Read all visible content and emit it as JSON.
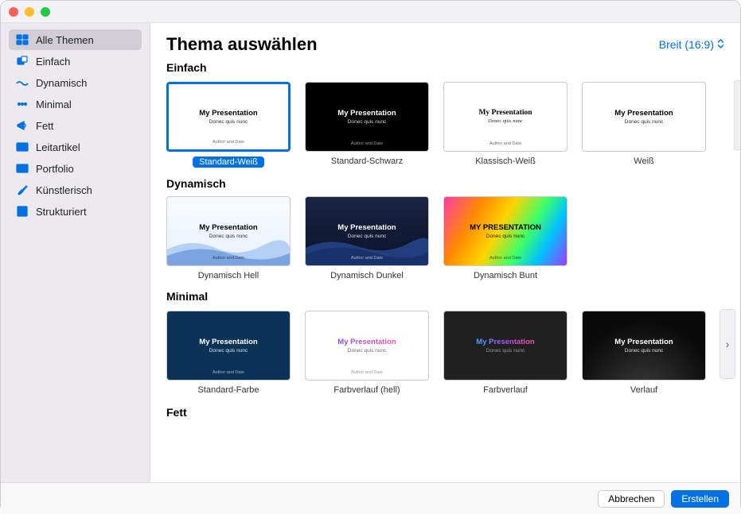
{
  "header": {
    "title": "Thema auswählen",
    "ratio": "Breit (16:9)"
  },
  "thumb_text": {
    "title": "My Presentation",
    "title_upper": "MY PRESENTATION",
    "sub": "Donec quis nunc",
    "foot": "Author and Date"
  },
  "sidebar": [
    {
      "label": "Alle Themen",
      "icon": "grid",
      "selected": true
    },
    {
      "label": "Einfach",
      "icon": "squares",
      "selected": false
    },
    {
      "label": "Dynamisch",
      "icon": "wave",
      "selected": false
    },
    {
      "label": "Minimal",
      "icon": "dots",
      "selected": false
    },
    {
      "label": "Fett",
      "icon": "megaphone",
      "selected": false
    },
    {
      "label": "Leitartikel",
      "icon": "slide",
      "selected": false
    },
    {
      "label": "Portfolio",
      "icon": "slide",
      "selected": false
    },
    {
      "label": "Künstlerisch",
      "icon": "brush",
      "selected": false
    },
    {
      "label": "Strukturiert",
      "icon": "texture",
      "selected": false
    }
  ],
  "sections": [
    {
      "title": "Einfach",
      "scroll": false,
      "peek": true,
      "cards": [
        {
          "name": "Standard-Weiß",
          "bg": "#ffffff",
          "fg": "#000000",
          "center": false,
          "foot": true,
          "selected": true
        },
        {
          "name": "Standard-Schwarz",
          "bg": "#000000",
          "fg": "#ffffff",
          "center": false,
          "foot": true,
          "selected": false
        },
        {
          "name": "Klassisch-Weiß",
          "bg": "#ffffff",
          "fg": "#000000",
          "center": true,
          "foot": true,
          "serif": true,
          "selected": false
        },
        {
          "name": "Weiß",
          "bg": "#ffffff",
          "fg": "#000000",
          "center": true,
          "foot": false,
          "selected": false
        }
      ]
    },
    {
      "title": "Dynamisch",
      "scroll": false,
      "peek": false,
      "cards": [
        {
          "name": "Dynamisch Hell",
          "style": "wave-light",
          "fg": "#000000",
          "center": false,
          "foot": true,
          "selected": false
        },
        {
          "name": "Dynamisch Dunkel",
          "style": "wave-dark",
          "fg": "#ffffff",
          "center": false,
          "foot": true,
          "selected": false
        },
        {
          "name": "Dynamisch Bunt",
          "style": "rainbow",
          "fg": "#000000",
          "center": false,
          "upper": true,
          "foot": true,
          "selected": false
        }
      ]
    },
    {
      "title": "Minimal",
      "scroll": true,
      "peek": false,
      "cards": [
        {
          "name": "Standard-Farbe",
          "bg": "#0b3358",
          "fg": "#ffffff",
          "center": false,
          "foot": true,
          "selected": false
        },
        {
          "name": "Farbverlauf (hell)",
          "bg": "#ffffff",
          "fg_grad": "light",
          "center": true,
          "foot": true,
          "selected": false
        },
        {
          "name": "Farbverlauf",
          "bg": "#202020",
          "fg_grad": "dark",
          "center": true,
          "foot": false,
          "selected": false
        },
        {
          "name": "Verlauf",
          "style": "dark-grad",
          "fg": "#ffffff",
          "center": true,
          "foot": false,
          "selected": false
        }
      ]
    },
    {
      "title": "Fett",
      "scroll": false,
      "peek": false,
      "cards": []
    }
  ],
  "footer": {
    "cancel": "Abbrechen",
    "create": "Erstellen"
  },
  "colors": {
    "accent": "#0071e3"
  }
}
